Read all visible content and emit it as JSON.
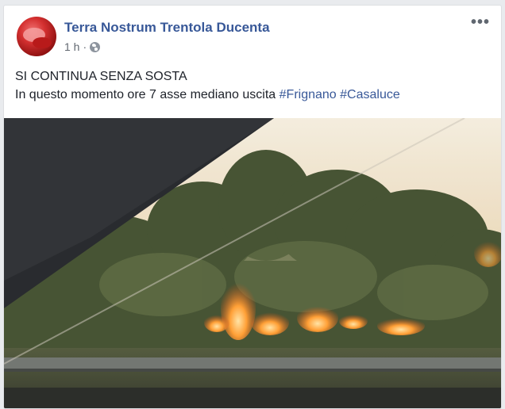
{
  "post": {
    "page_name": "Terra Nostrum Trentola Ducenta",
    "time": "1 h",
    "dot": "·",
    "privacy_icon": "globe-icon",
    "menu_icon": "more-options-icon",
    "more_label": "•••",
    "text_line1": "SI CONTINUA SENZA SOSTA",
    "text_line2_prefix": "In questo momento ore 7 asse mediano uscita",
    "hashtags": [
      "#Frignano",
      "#Casaluce"
    ]
  },
  "colors": {
    "link": "#385898",
    "text": "#1d2129",
    "meta": "#616770",
    "background": "#e9ebee"
  }
}
